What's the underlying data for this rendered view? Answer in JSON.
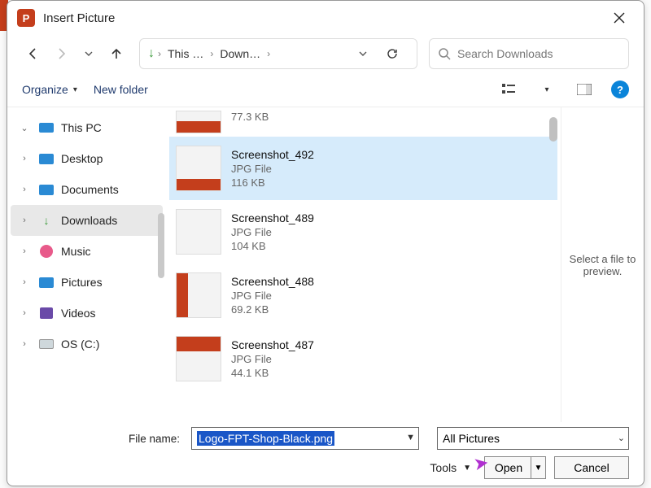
{
  "window": {
    "title": "Insert Picture"
  },
  "breadcrumb": {
    "segments": [
      "This …",
      "Down…"
    ]
  },
  "search": {
    "placeholder": "Search Downloads"
  },
  "toolbar": {
    "organize": "Organize",
    "new_folder": "New folder"
  },
  "sidebar": {
    "root": "This PC",
    "items": [
      {
        "label": "Desktop",
        "icon": "desktop"
      },
      {
        "label": "Documents",
        "icon": "documents"
      },
      {
        "label": "Downloads",
        "icon": "downloads",
        "selected": true
      },
      {
        "label": "Music",
        "icon": "music"
      },
      {
        "label": "Pictures",
        "icon": "pictures"
      },
      {
        "label": "Videos",
        "icon": "videos"
      },
      {
        "label": "OS (C:)",
        "icon": "drive"
      }
    ]
  },
  "files": {
    "partial_size": "77.3 KB",
    "items": [
      {
        "name": "Screenshot_492",
        "type": "JPG File",
        "size": "116 KB",
        "selected": true
      },
      {
        "name": "Screenshot_489",
        "type": "JPG File",
        "size": "104 KB"
      },
      {
        "name": "Screenshot_488",
        "type": "JPG File",
        "size": "69.2 KB"
      },
      {
        "name": "Screenshot_487",
        "type": "JPG File",
        "size": "44.1 KB"
      }
    ]
  },
  "preview": {
    "empty_text": "Select a file to preview."
  },
  "footer": {
    "file_name_label": "File name:",
    "file_name_value": "Logo-FPT-Shop-Black.png",
    "filter_label": "All Pictures",
    "tools_label": "Tools",
    "open_label": "Open",
    "cancel_label": "Cancel"
  }
}
